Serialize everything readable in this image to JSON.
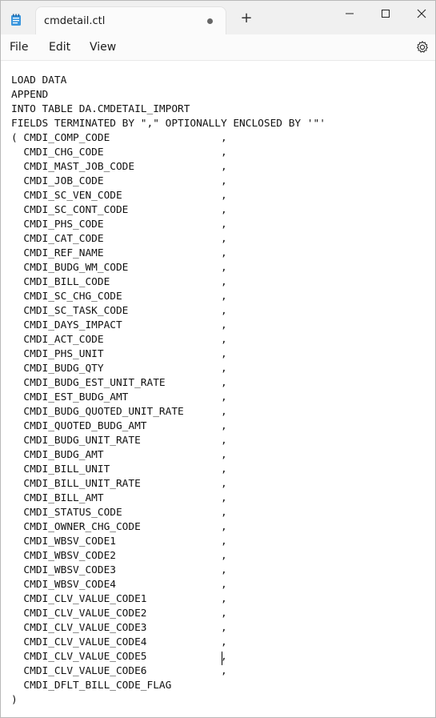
{
  "window": {
    "tab_title": "cmdetail.ctl",
    "new_tab_symbol": "+",
    "icons": {
      "app": "notepad-icon",
      "unsaved": "unsaved-dot-icon",
      "minimize": "minimize-icon",
      "maximize": "maximize-icon",
      "close": "close-icon",
      "settings": "gear-icon"
    }
  },
  "menu": {
    "file": "File",
    "edit": "Edit",
    "view": "View"
  },
  "editor": {
    "lines": [
      "LOAD DATA",
      "APPEND",
      "INTO TABLE DA.CMDETAIL_IMPORT",
      "FIELDS TERMINATED BY \",\" OPTIONALLY ENCLOSED BY '\"'",
      "( CMDI_COMP_CODE                  ,",
      "  CMDI_CHG_CODE                   ,",
      "  CMDI_MAST_JOB_CODE              ,",
      "  CMDI_JOB_CODE                   ,",
      "  CMDI_SC_VEN_CODE                ,",
      "  CMDI_SC_CONT_CODE               ,",
      "  CMDI_PHS_CODE                   ,",
      "  CMDI_CAT_CODE                   ,",
      "  CMDI_REF_NAME                   ,",
      "  CMDI_BUDG_WM_CODE               ,",
      "  CMDI_BILL_CODE                  ,",
      "  CMDI_SC_CHG_CODE                ,",
      "  CMDI_SC_TASK_CODE               ,",
      "  CMDI_DAYS_IMPACT                ,",
      "  CMDI_ACT_CODE                   ,",
      "  CMDI_PHS_UNIT                   ,",
      "  CMDI_BUDG_QTY                   ,",
      "  CMDI_BUDG_EST_UNIT_RATE         ,",
      "  CMDI_EST_BUDG_AMT               ,",
      "  CMDI_BUDG_QUOTED_UNIT_RATE      ,",
      "  CMDI_QUOTED_BUDG_AMT            ,",
      "  CMDI_BUDG_UNIT_RATE             ,",
      "  CMDI_BUDG_AMT                   ,",
      "  CMDI_BILL_UNIT                  ,",
      "  CMDI_BILL_UNIT_RATE             ,",
      "  CMDI_BILL_AMT                   ,",
      "  CMDI_STATUS_CODE                ,",
      "  CMDI_OWNER_CHG_CODE             ,",
      "  CMDI_WBSV_CODE1                 ,",
      "  CMDI_WBSV_CODE2                 ,",
      "  CMDI_WBSV_CODE3                 ,",
      "  CMDI_WBSV_CODE4                 ,",
      "  CMDI_CLV_VALUE_CODE1            ,",
      "  CMDI_CLV_VALUE_CODE2            ,",
      "  CMDI_CLV_VALUE_CODE3            ,",
      "  CMDI_CLV_VALUE_CODE4            ,",
      "  CMDI_CLV_VALUE_CODE5            ,",
      "  CMDI_CLV_VALUE_CODE6            ,",
      "  CMDI_DFLT_BILL_CODE_FLAG",
      ")"
    ]
  }
}
